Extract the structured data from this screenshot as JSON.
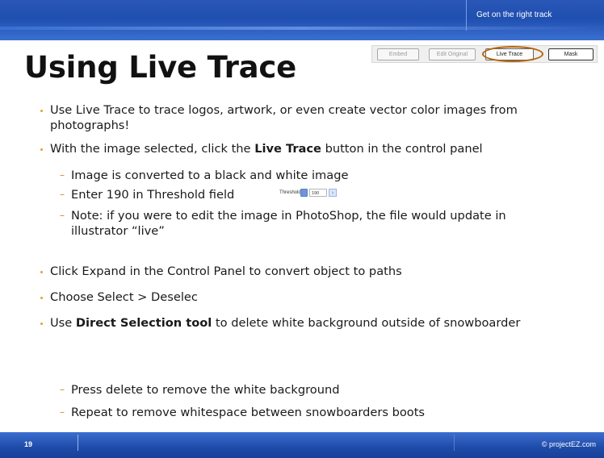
{
  "header": {
    "tagline": "Get on the right track"
  },
  "slide": {
    "title": "Using Live Trace"
  },
  "control_panel": {
    "buttons": [
      "Embed",
      "Edit Original",
      "Live Trace",
      "Mask"
    ]
  },
  "bullets": {
    "b1": "Use Live Trace to trace logos, artwork, or even create vector color images from photographs!",
    "b2_pre": "With the image selected, click the ",
    "b2_bold": "Live Trace",
    "b2_post": " button in the control panel",
    "b2_sub1": "Image is converted to a black and white image",
    "b2_sub2": "Enter 190 in Threshold field",
    "b2_sub3": "Note:  if you were to edit the image in PhotoShop, the file would update in illustrator “live”",
    "b3": "Click Expand in the Control Panel to convert object to paths",
    "b4": "Choose Select > Deselec",
    "b5_pre": "Use ",
    "b5_bold": "Direct Selection tool",
    "b5_post": " to delete white background outside of snowboarder",
    "b5_sub1": "Press delete to remove the white background",
    "b5_sub2": "Repeat to remove whitespace between snowboarders boots"
  },
  "threshold_widget": {
    "label": "Threshold:",
    "value": "190"
  },
  "footer": {
    "page_number": "19",
    "copyright": "© projectEZ.com"
  },
  "colors": {
    "banner": "#1f4fb0",
    "bullet": "#e6a12c",
    "highlight_circle": "#b5650c"
  },
  "icons": {
    "threshold_spinner": "spinner-icon",
    "threshold_arrow": "chevron-right-icon"
  }
}
